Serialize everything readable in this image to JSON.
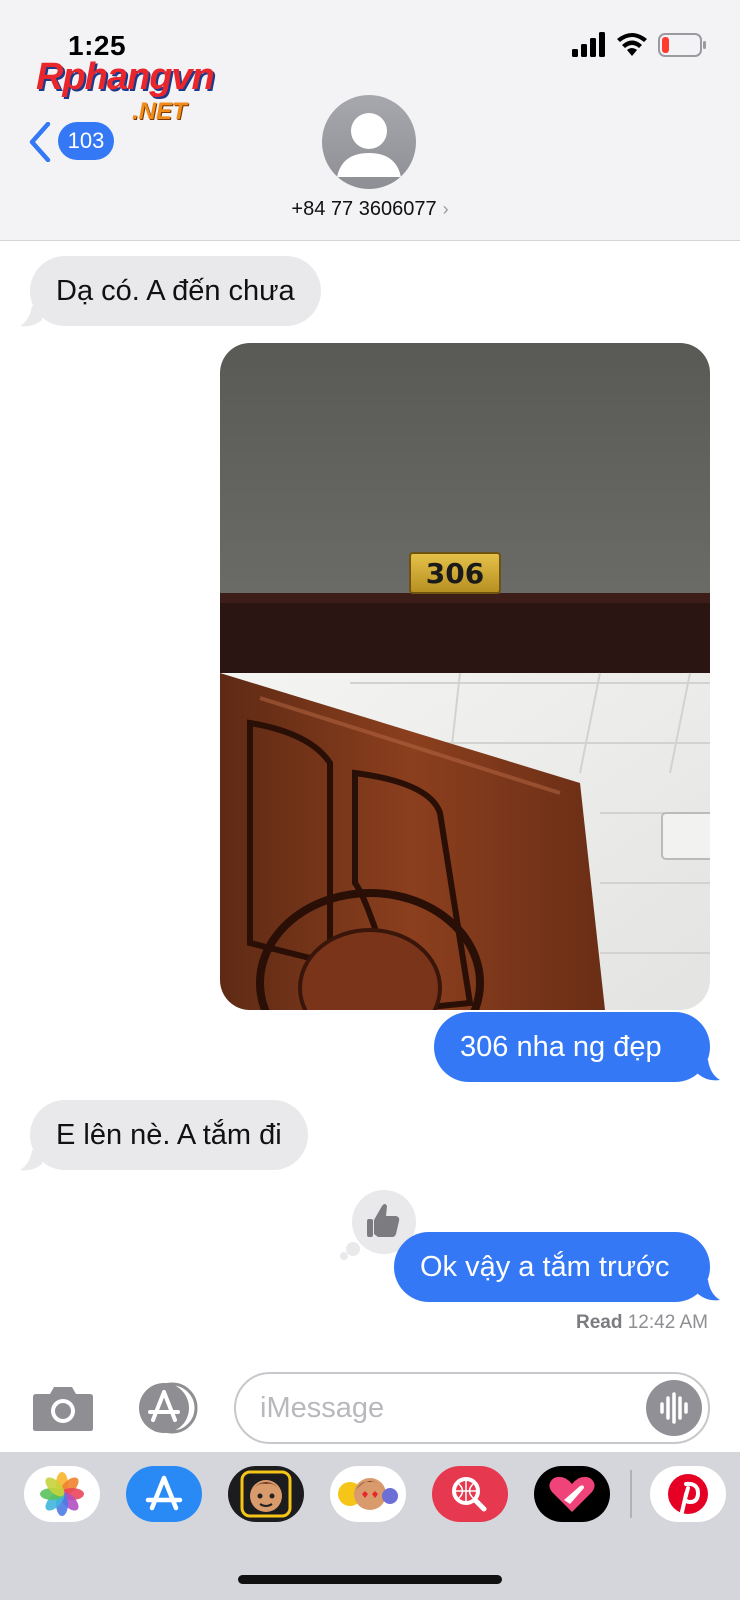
{
  "status_bar": {
    "time": "1:25"
  },
  "watermark": {
    "brand": "Rphangvn",
    "suffix": ".NET"
  },
  "nav": {
    "back_badge": "103",
    "contact": "+84 77 3606077"
  },
  "photo": {
    "door_number": "306"
  },
  "messages": [
    {
      "side": "in",
      "text": "Dạ có. A đến chưa"
    },
    {
      "side": "out",
      "text": "306 nha ng đẹp"
    },
    {
      "side": "in",
      "text": "E lên nè. A tắm đi"
    },
    {
      "side": "out",
      "text": "Ok vậy a tắm trước"
    }
  ],
  "read_receipt": {
    "label": "Read",
    "time": "12:42 AM"
  },
  "composer": {
    "placeholder": "iMessage"
  },
  "apps": [
    "photos-app",
    "appstore-app",
    "memoji-app",
    "animoji-stickers-app",
    "image-search-app",
    "digital-touch-app",
    "pinterest-app"
  ],
  "colors": {
    "blue": "#3478f6",
    "gray_bubble": "#e9e9eb",
    "battery_low": "#ff3b30"
  }
}
